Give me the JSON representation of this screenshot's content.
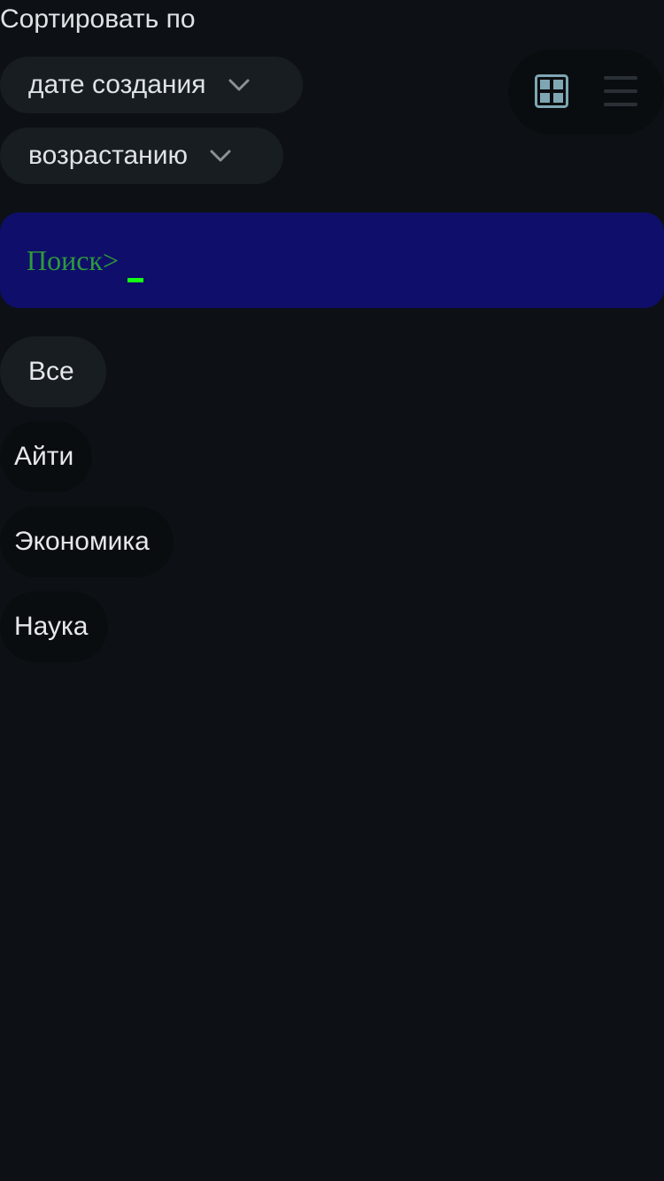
{
  "sort": {
    "label": "Сортировать по",
    "field_value": "дате создания",
    "order_value": "возрастанию"
  },
  "view_toggle": {
    "grid_icon": "grid-icon",
    "list_icon": "list-icon",
    "active": "grid",
    "active_color": "#7fa6b3",
    "inactive_color": "#2a3036"
  },
  "search": {
    "prompt": "Поиск>",
    "value": "",
    "prompt_color": "#2f9a3a",
    "cursor_color": "#14ff14",
    "background": "#0f0e6b"
  },
  "categories": [
    {
      "label": "Все",
      "selected": true
    },
    {
      "label": "Айти",
      "selected": false
    },
    {
      "label": "Экономика",
      "selected": false
    },
    {
      "label": "Наука",
      "selected": false
    }
  ]
}
